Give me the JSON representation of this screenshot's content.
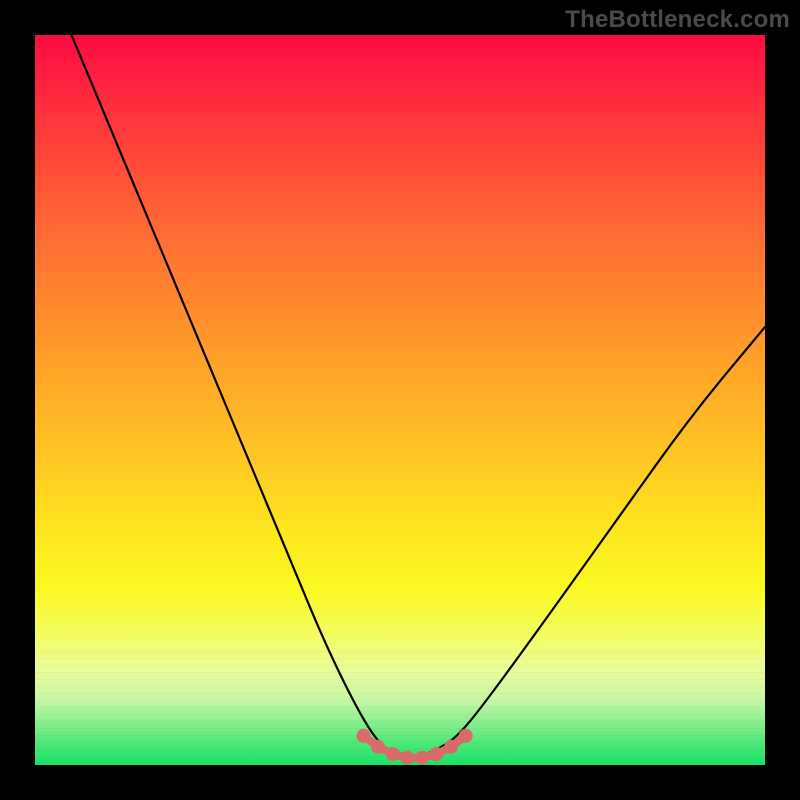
{
  "watermark": "TheBottleneck.com",
  "chart_data": {
    "type": "line",
    "title": "",
    "xlabel": "",
    "ylabel": "",
    "xlim": [
      0,
      100
    ],
    "ylim": [
      0,
      100
    ],
    "grid": false,
    "series": [
      {
        "name": "bottleneck-curve",
        "x": [
          5,
          10,
          15,
          20,
          25,
          30,
          35,
          40,
          45,
          48,
          50,
          52,
          55,
          58,
          62,
          70,
          80,
          90,
          100
        ],
        "y": [
          100,
          88,
          76,
          64,
          52,
          40,
          28,
          16,
          6,
          2,
          1,
          1,
          2,
          4,
          9,
          20,
          34,
          48,
          60
        ]
      }
    ],
    "highlight": {
      "name": "minimum-region",
      "x": [
        45,
        47,
        49,
        51,
        53,
        55,
        57,
        59
      ],
      "y": [
        4,
        2.5,
        1.5,
        1,
        1,
        1.5,
        2.5,
        4
      ]
    },
    "colors": {
      "curve": "#000000",
      "highlight": "#d96a6a",
      "gradient_top": "#ff0b42",
      "gradient_mid": "#ffe61f",
      "gradient_bottom": "#19e36a",
      "frame": "#000000"
    }
  }
}
